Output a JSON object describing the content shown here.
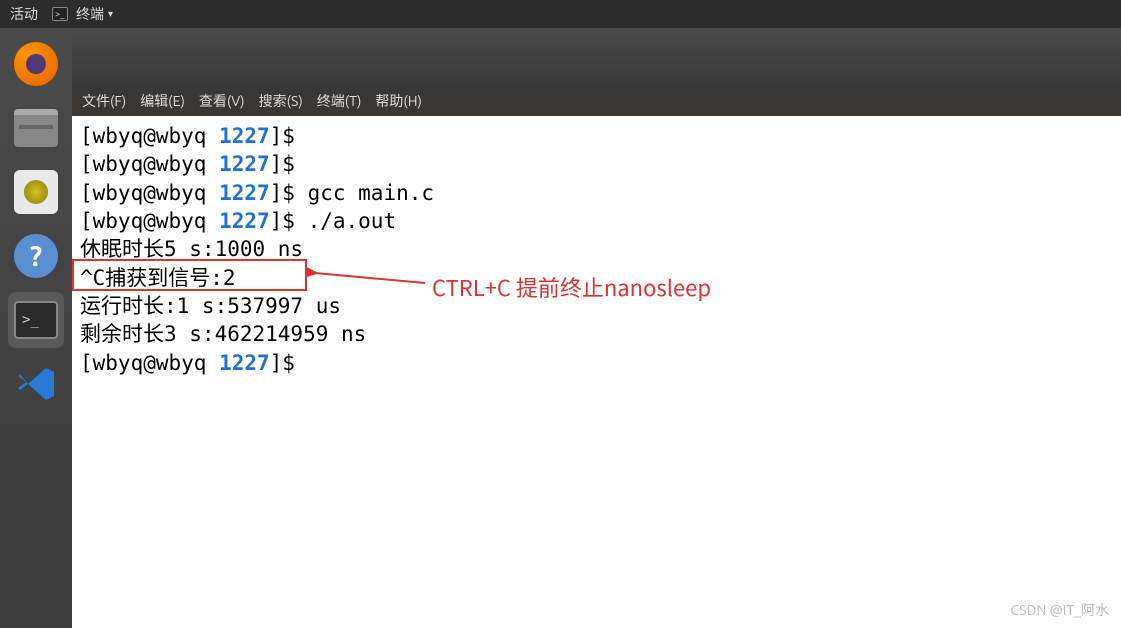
{
  "topbar": {
    "activities": "活动",
    "app_name": "终端"
  },
  "launcher": {
    "items": [
      {
        "name": "firefox",
        "active": false
      },
      {
        "name": "files",
        "active": false
      },
      {
        "name": "music",
        "active": false
      },
      {
        "name": "help",
        "active": false
      },
      {
        "name": "terminal",
        "active": true
      },
      {
        "name": "vscode",
        "active": false
      }
    ]
  },
  "terminal_menu": {
    "file": "文件(F)",
    "edit": "编辑(E)",
    "view": "查看(V)",
    "search": "搜索(S)",
    "terminal": "终端(T)",
    "help": "帮助(H)"
  },
  "terminal": {
    "user": "wbyq",
    "host": "wbyq",
    "dir": "1227",
    "lines": [
      {
        "type": "prompt",
        "cmd": ""
      },
      {
        "type": "prompt",
        "cmd": ""
      },
      {
        "type": "prompt",
        "cmd": "gcc main.c"
      },
      {
        "type": "prompt",
        "cmd": "./a.out"
      },
      {
        "type": "output",
        "text": "休眠时长5 s:1000 ns"
      },
      {
        "type": "output",
        "text": "^C捕获到信号:2"
      },
      {
        "type": "output",
        "text": "运行时长:1 s:537997 us"
      },
      {
        "type": "output",
        "text": "剩余时长3 s:462214959 ns"
      },
      {
        "type": "prompt",
        "cmd": ""
      }
    ]
  },
  "annotation": {
    "text": "CTRL+C 提前终止nanosleep"
  },
  "watermark": "CSDN @IT_阿水"
}
